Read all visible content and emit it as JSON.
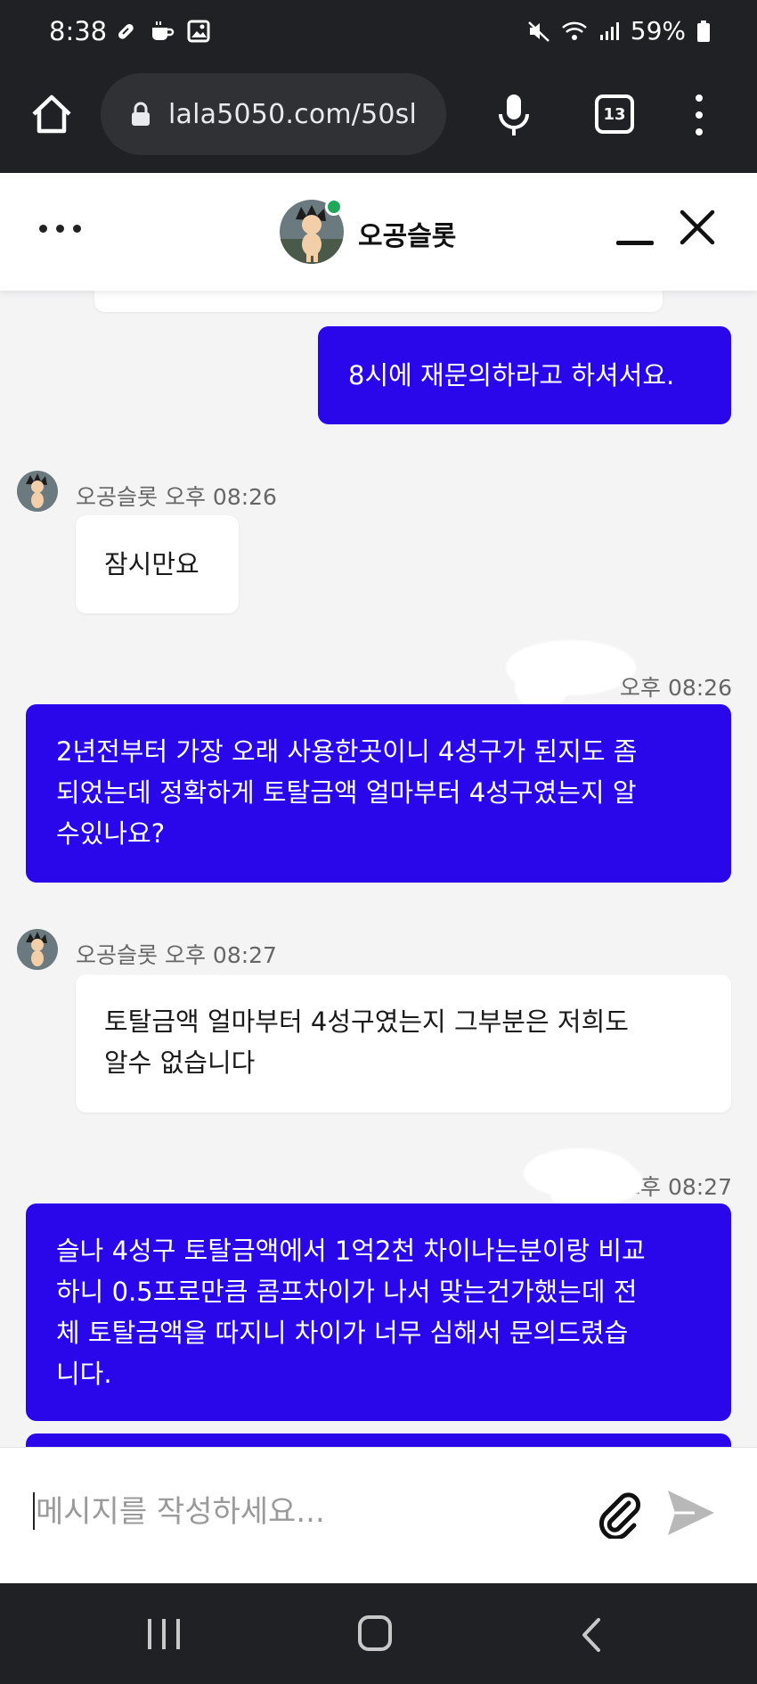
{
  "status_bar": {
    "time": "8:38",
    "battery": "59%"
  },
  "browser": {
    "url": "lala5050.com/50sl",
    "tab_count": "13"
  },
  "chat_header": {
    "title": "오공슬롯"
  },
  "messages": [
    {
      "direction": "outgoing",
      "lines": [
        "8시에 재문의하라고 하셔서요."
      ]
    },
    {
      "direction": "incoming",
      "sender": "오공슬롯",
      "time": "오후 08:26",
      "lines": [
        "잠시만요"
      ]
    },
    {
      "direction": "outgoing",
      "time": "오후 08:26",
      "lines": [
        "2년전부터 가장 오래 사용한곳이니 4성구가 된지도 좀",
        "되었는데 정확하게 토탈금액 얼마부터 4성구였는지 알",
        "수있나요?"
      ]
    },
    {
      "direction": "incoming",
      "sender": "오공슬롯",
      "time": "오후 08:27",
      "lines": [
        "토탈금액 얼마부터 4성구였는지 그부분은 저희도",
        "알수 없습니다"
      ]
    },
    {
      "direction": "outgoing",
      "time": "오후 08:27",
      "lines": [
        "슬나 4성구 토탈금액에서 1억2천 차이나는분이랑 비교",
        "하니 0.5프로만큼 콤프차이가 나서 맞는건가했는데 전",
        "체 토탈금액을 따지니 차이가 너무 심해서 문의드렸습",
        "니다."
      ]
    }
  ],
  "composer": {
    "placeholder": "메시지를 작성하세요..."
  },
  "colors": {
    "outgoing_bubble": "#2a06ea",
    "incoming_bubble": "#ffffff",
    "chat_background": "#f4f4f5",
    "online_status": "#1fa85a",
    "system_bar": "#202124"
  },
  "icons": [
    "home-icon",
    "lock-icon",
    "mic-icon",
    "tabs-icon",
    "more-vert-icon",
    "more-horiz-icon",
    "minimize-icon",
    "close-icon",
    "attach-icon",
    "send-icon",
    "nav-recents-icon",
    "nav-home-icon",
    "nav-back-icon"
  ]
}
